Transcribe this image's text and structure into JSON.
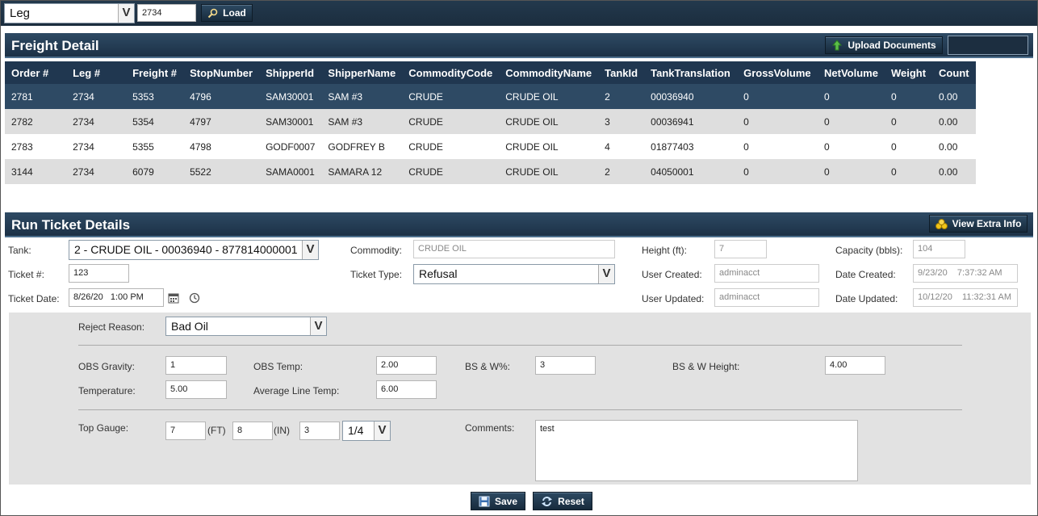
{
  "toolbar": {
    "type_select": "Leg",
    "id_value": "2734",
    "load_label": "Load"
  },
  "freight": {
    "title": "Freight Detail",
    "upload_label": "Upload Documents",
    "columns": [
      "Order #",
      "Leg #",
      "Freight #",
      "StopNumber",
      "ShipperId",
      "ShipperName",
      "CommodityCode",
      "CommodityName",
      "TankId",
      "TankTranslation",
      "GrossVolume",
      "NetVolume",
      "Weight",
      "Count"
    ],
    "rows": [
      [
        "2781",
        "2734",
        "5353",
        "4796",
        "SAM30001",
        "SAM #3",
        "CRUDE",
        "CRUDE OIL",
        "2",
        "00036940",
        "0",
        "0",
        "0",
        "0.00"
      ],
      [
        "2782",
        "2734",
        "5354",
        "4797",
        "SAM30001",
        "SAM #3",
        "CRUDE",
        "CRUDE OIL",
        "3",
        "00036941",
        "0",
        "0",
        "0",
        "0.00"
      ],
      [
        "2783",
        "2734",
        "5355",
        "4798",
        "GODF0007",
        "GODFREY B",
        "CRUDE",
        "CRUDE OIL",
        "4",
        "01877403",
        "0",
        "0",
        "0",
        "0.00"
      ],
      [
        "3144",
        "2734",
        "6079",
        "5522",
        "SAMA0001",
        "SAMARA 12",
        "CRUDE",
        "CRUDE OIL",
        "2",
        "04050001",
        "0",
        "0",
        "0",
        "0.00"
      ]
    ]
  },
  "run": {
    "title": "Run Ticket Details",
    "extra_label": "View Extra Info",
    "tank_label": "Tank:",
    "tank_value": "2 - CRUDE OIL - 00036940 - 877814000001",
    "ticket_label": "Ticket #:",
    "ticket_value": "123",
    "date_label": "Ticket Date:",
    "date_value": "8/26/20   1:00 PM",
    "commodity_label": "Commodity:",
    "commodity_value": "CRUDE OIL",
    "type_label": "Ticket Type:",
    "type_value": "Refusal",
    "height_label": "Height (ft):",
    "height_value": "7",
    "capacity_label": "Capacity (bbls):",
    "capacity_value": "104",
    "ucreated_label": "User Created:",
    "ucreated_value": "adminacct",
    "dcreated_label": "Date Created:",
    "dcreated_value": "9/23/20    7:37:32 AM",
    "uupdated_label": "User Updated:",
    "uupdated_value": "adminacct",
    "dupdated_label": "Date Updated:",
    "dupdated_value": "10/12/20    11:32:31 AM",
    "reject_label": "Reject Reason:",
    "reject_value": "Bad Oil",
    "obsg_label": "OBS Gravity:",
    "obsg_value": "1",
    "obst_label": "OBS Temp:",
    "obst_value": "2.00",
    "bsw_label": "BS & W%:",
    "bsw_value": "3",
    "bswh_label": "BS & W Height:",
    "bswh_value": "4.00",
    "temp_label": "Temperature:",
    "temp_value": "5.00",
    "alt_label": "Average Line Temp:",
    "alt_value": "6.00",
    "gauge_label": "Top Gauge:",
    "gauge_ft": "7",
    "ft_unit": "(FT)",
    "gauge_in": "8",
    "in_unit": "(IN)",
    "gauge_q": "3",
    "gauge_frac": "1/4",
    "comments_label": "Comments:",
    "comments_value": "test",
    "save_label": "Save",
    "reset_label": "Reset"
  }
}
